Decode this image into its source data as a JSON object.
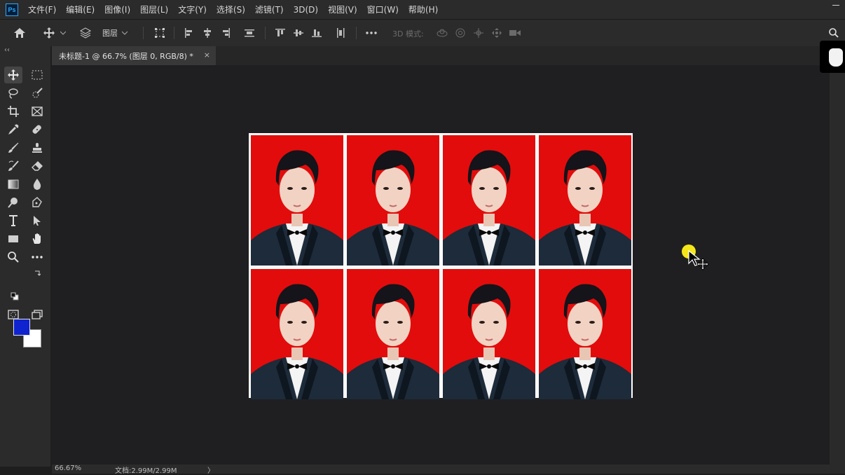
{
  "app": {
    "logo": "Ps"
  },
  "menu": [
    "文件(F)",
    "编辑(E)",
    "图像(I)",
    "图层(L)",
    "文字(Y)",
    "选择(S)",
    "滤镜(T)",
    "3D(D)",
    "视图(V)",
    "窗口(W)",
    "帮助(H)"
  ],
  "options": {
    "layer_select": "图层",
    "mode_label": "3D 模式:"
  },
  "document": {
    "tab_title": "未标题-1 @ 66.7% (图层 0, RGB/8) *",
    "close_glyph": "×"
  },
  "colors": {
    "foreground": "#0f23cf",
    "background": "#ffffff",
    "photo_bg": "#e20c0c"
  },
  "status": {
    "zoom": "66.67%",
    "doc_size": "文档:2.99M/2.99M",
    "arrow": "〉"
  },
  "sheet": {
    "rows": 2,
    "cols": 4,
    "photo_count": 8
  }
}
